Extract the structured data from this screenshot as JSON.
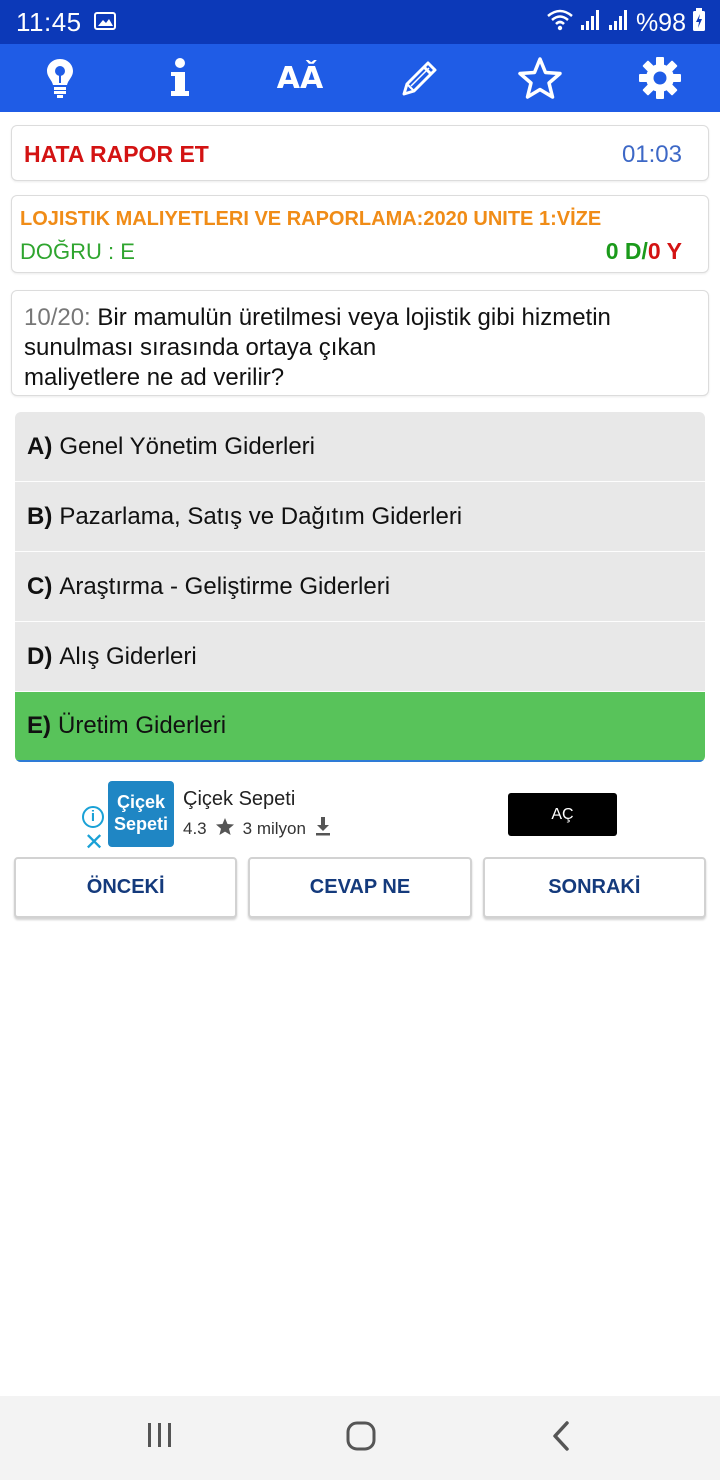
{
  "status_bar": {
    "time": "11:45",
    "battery": "%98",
    "icons": [
      "image-icon",
      "wifi-icon",
      "signal-icon",
      "signal-icon",
      "charging-battery-icon"
    ]
  },
  "toolbar": {
    "icons": [
      "lightbulb-icon",
      "info-icon",
      "font-size-icon",
      "pencil-icon",
      "star-icon",
      "gear-icon"
    ],
    "font_icon_text": "AǍ"
  },
  "report": {
    "label": "HATA RAPOR ET",
    "timer": "01:03"
  },
  "quiz_info": {
    "course": "LOJISTIK MALIYETLERI VE RAPORLAMA:2020 UNITE 1:VİZE",
    "correct_answer": "DOĞRU : E",
    "score_correct": "0 D",
    "score_separator": "/",
    "score_wrong": "0 Y"
  },
  "question": {
    "number": "10/20:",
    "line1": " Bir mamulün üretilmesi veya lojistik gibi hizmetin",
    "line2": "sunulması sırasında ortaya çıkan",
    "line3": "maliyetlere ne ad verilir?"
  },
  "options": [
    {
      "letter": "A)",
      "text": "Genel Yönetim Giderleri"
    },
    {
      "letter": "B)",
      "text": "Pazarlama, Satış ve Dağıtım Giderleri"
    },
    {
      "letter": "C)",
      "text": "Araştırma - Geliştirme Giderleri"
    },
    {
      "letter": "D)",
      "text": "Alış Giderleri"
    },
    {
      "letter": "E)",
      "text": "Üretim Giderleri"
    }
  ],
  "ad": {
    "logo_line1": "Çiçek",
    "logo_line2": "Sepeti",
    "app_name": "Çiçek Sepeti",
    "rating": "4.3",
    "downloads": "3 milyon",
    "open_label": "AÇ"
  },
  "nav_buttons": {
    "prev": "ÖNCEKİ",
    "answer": "CEVAP NE",
    "next": "SONRAKİ"
  },
  "colors": {
    "status_bar": "#0c39b8",
    "toolbar": "#1f5ce6",
    "correct_option": "#58c35a",
    "error_red": "#d31313",
    "course_orange": "#f08c17"
  }
}
